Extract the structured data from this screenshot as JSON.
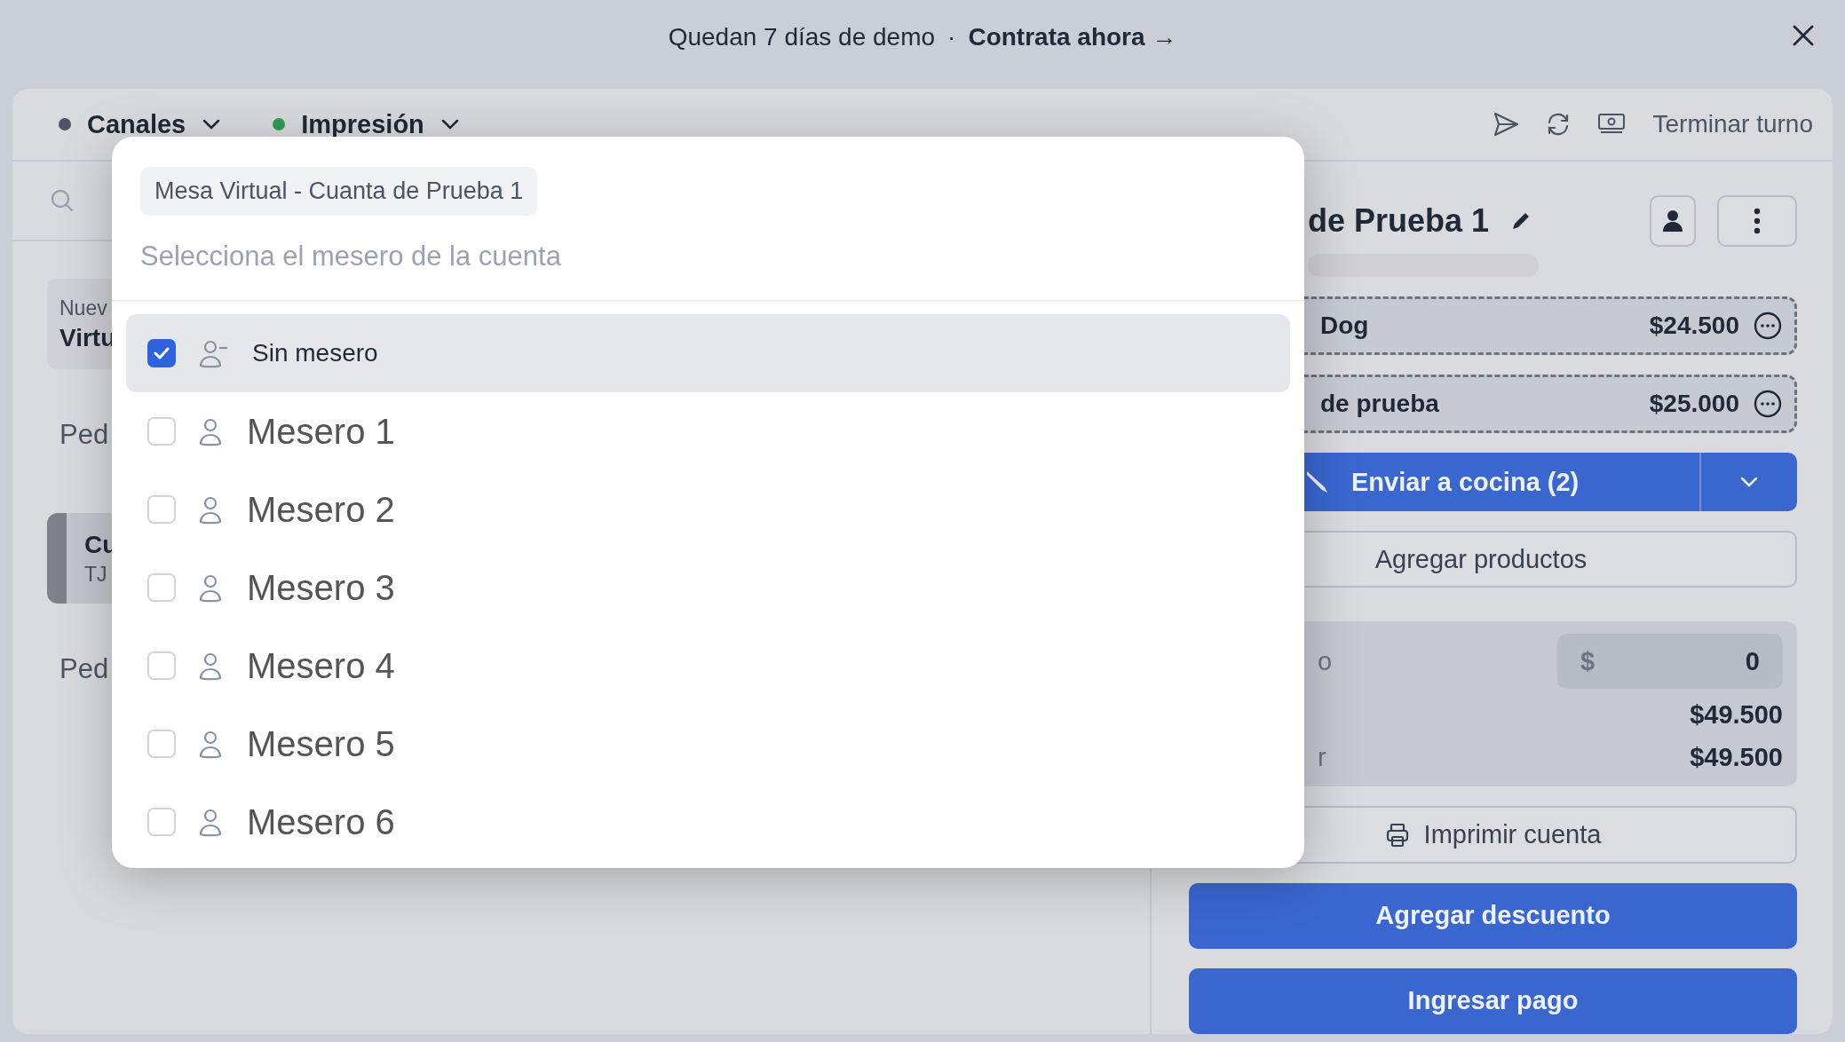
{
  "banner": {
    "text": "Quedan 7 días de demo",
    "separator": "·",
    "link": "Contrata ahora →"
  },
  "header": {
    "channels": [
      {
        "label": "Canales",
        "color": "#4b5563"
      },
      {
        "label": "Impresión",
        "color": "#2f9e55"
      }
    ],
    "end_shift": "Terminar turno"
  },
  "orders_list": [
    {
      "kind": "card",
      "selected": false,
      "lines": [
        {
          "kind": "caption",
          "text": "Nuev"
        },
        {
          "kind": "title",
          "text": "Virtu"
        }
      ]
    },
    {
      "kind": "heading",
      "text": "Ped"
    },
    {
      "kind": "card",
      "selected": true,
      "lines": [
        {
          "kind": "title",
          "text": "Cu"
        },
        {
          "kind": "caption",
          "text": "TJ"
        }
      ]
    },
    {
      "kind": "heading",
      "text": "Ped"
    }
  ],
  "account": {
    "title": "de Prueba 1",
    "items": [
      {
        "name": "Dog",
        "price": "$24.500"
      },
      {
        "name": "de prueba",
        "price": "$25.000"
      }
    ],
    "send_button": "Enviar a cocina (2)",
    "add_products": "Agregar productos",
    "totals": [
      {
        "kind": "input",
        "label": "o",
        "currency": "$",
        "value": "0"
      },
      {
        "kind": "amount",
        "value": "$49.500"
      },
      {
        "kind": "amount",
        "label": "r",
        "value": "$49.500"
      }
    ],
    "print_button": "Imprimir cuenta",
    "discount_button": "Agregar descuento",
    "pay_button": "Ingresar pago"
  },
  "modal": {
    "chip": "Mesa Virtual - Cuanta de Prueba 1",
    "search": {
      "placeholder": "Selecciona el mesero de la cuenta"
    },
    "waiters": [
      {
        "kind": "none",
        "name": "Sin mesero",
        "selected": true
      },
      {
        "kind": "person",
        "name": "Mesero 1",
        "selected": false
      },
      {
        "kind": "person",
        "name": "Mesero 2",
        "selected": false
      },
      {
        "kind": "person",
        "name": "Mesero 3",
        "selected": false
      },
      {
        "kind": "person",
        "name": "Mesero 4",
        "selected": false
      },
      {
        "kind": "person",
        "name": "Mesero 5",
        "selected": false
      },
      {
        "kind": "person",
        "name": "Mesero 6",
        "selected": false
      }
    ]
  }
}
